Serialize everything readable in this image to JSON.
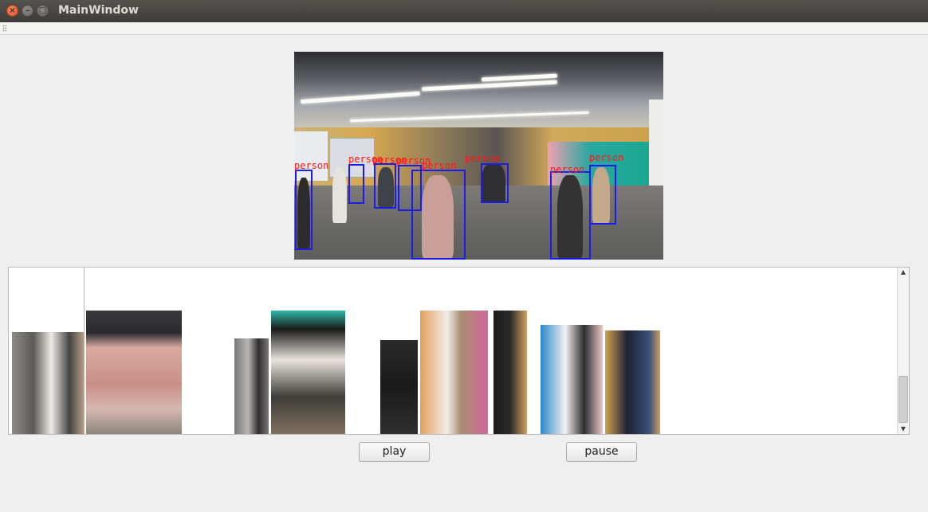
{
  "window": {
    "title": "MainWindow"
  },
  "titlebar_controls": {
    "close_icon": "close-icon",
    "minimize_icon": "minimize-icon",
    "maximize_icon": "maximize-icon",
    "close_glyph": "×",
    "minimize_glyph": "–",
    "maximize_glyph": "□"
  },
  "video": {
    "detection_label": "person",
    "box_color": "#1c1ce8",
    "label_color": "#ff1515"
  },
  "gallery": {
    "crop_count": 10,
    "scroll_up_glyph": "▲",
    "scroll_down_glyph": "▼"
  },
  "controls": {
    "play_label": "play",
    "pause_label": "pause"
  }
}
